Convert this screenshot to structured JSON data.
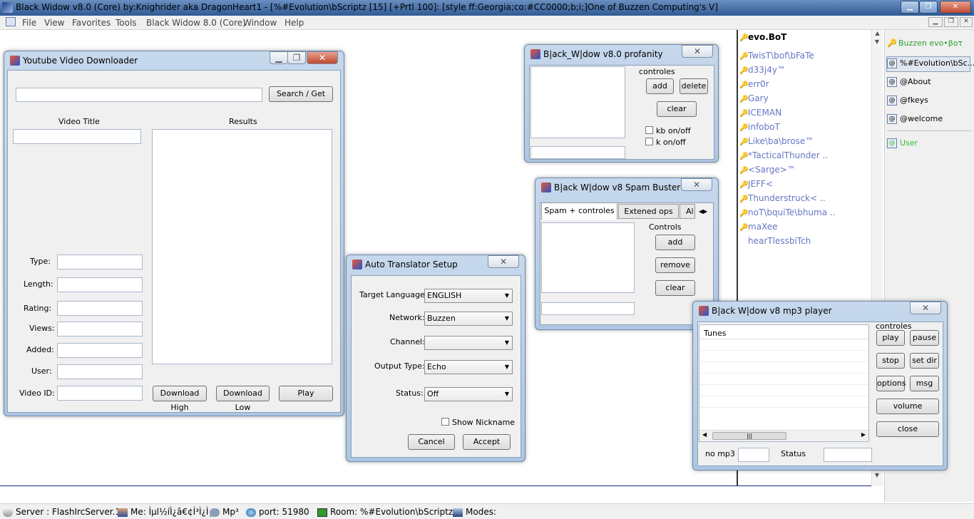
{
  "app": {
    "title": "Black Widow v8.0 (Core) by:Knighrider aka DragonHeart1 - [%#Evolution\\bScriptz [15] [+Prtl 100]: [style ff:Georgia;co:#CC0000;b;i;]One of Buzzen Computing's V]"
  },
  "menu": [
    "File",
    "View",
    "Favorites",
    "Tools",
    "Black Widow 8.0 (Core)",
    "Window",
    "Help"
  ],
  "yt": {
    "title": "Youtube Video Downloader",
    "search_btn": "Search / Get",
    "video_title_label": "Video Title",
    "results_label": "Results",
    "type": "Type:",
    "length": "Length:",
    "rating": "Rating:",
    "views": "Views:",
    "added": "Added:",
    "user": "User:",
    "video_id": "Video ID:",
    "dl_high": "Download High",
    "dl_low": "Download Low",
    "play": "Play"
  },
  "prof": {
    "title": "B|ack_W|dow v8.0 profanity",
    "controles": "controles",
    "add": "add",
    "delete": "delete",
    "clear": "clear",
    "kb": "kb on/off",
    "k": "k on/off"
  },
  "spam": {
    "title": "B|ack W|dow v8 Spam Buster",
    "tab1": "Spam + controles",
    "tab2": "Extened ops",
    "tab3": "Al",
    "controls": "Controls",
    "add": "add",
    "remove": "remove",
    "clear": "clear"
  },
  "trans": {
    "title": "Auto Translator Setup",
    "target_label": "Target Language:",
    "target_val": "ENGLISH",
    "network_label": "Network:",
    "network_val": "Buzzen",
    "channel_label": "Channel:",
    "channel_val": "",
    "output_label": "Output Type:",
    "output_val": "Echo",
    "status_label": "Status:",
    "status_val": "Off",
    "show_nick": "Show Nickname",
    "cancel": "Cancel",
    "accept": "Accept"
  },
  "mp3": {
    "title": "B|ack W|dow v8 mp3 player",
    "tunes": "Tunes",
    "controles": "controles",
    "play": "play",
    "pause": "pause",
    "stop": "stop",
    "setdir": "set dir",
    "options": "options",
    "msg": "msg",
    "volume": "volume",
    "close": "close",
    "nomp3": "no mp3",
    "status": "Status"
  },
  "nicklist": {
    "header": "evo.BoT",
    "users": [
      "TwisT\\bof\\bFaTe",
      "d33j4y™",
      "err0r",
      "Gary",
      "ICEMAN",
      "infoboT",
      "Like\\ba\\brose™",
      "*TacticalThunder ..",
      "<Sarge>™",
      "JEFF<",
      "Thunderstruck< ..",
      "noT\\bquiTe\\bhuma ..",
      "maXee",
      "hearTlessbiTch"
    ]
  },
  "side": {
    "top": "Buzzen evo•βoτ",
    "items": [
      "%#Evolution\\bSc...",
      "@About",
      "@fkeys",
      "@welcome",
      "User"
    ]
  },
  "status": {
    "server": "Server : FlashIrcServer.1",
    "me": "Me: Ìµl½íÌ¿â€¢Í³Ì¿Ì¸",
    "mp3": "Mp³",
    "port": "port: 51980",
    "room": "Room: %#Evolution\\bScriptz",
    "modes": "Modes:"
  }
}
